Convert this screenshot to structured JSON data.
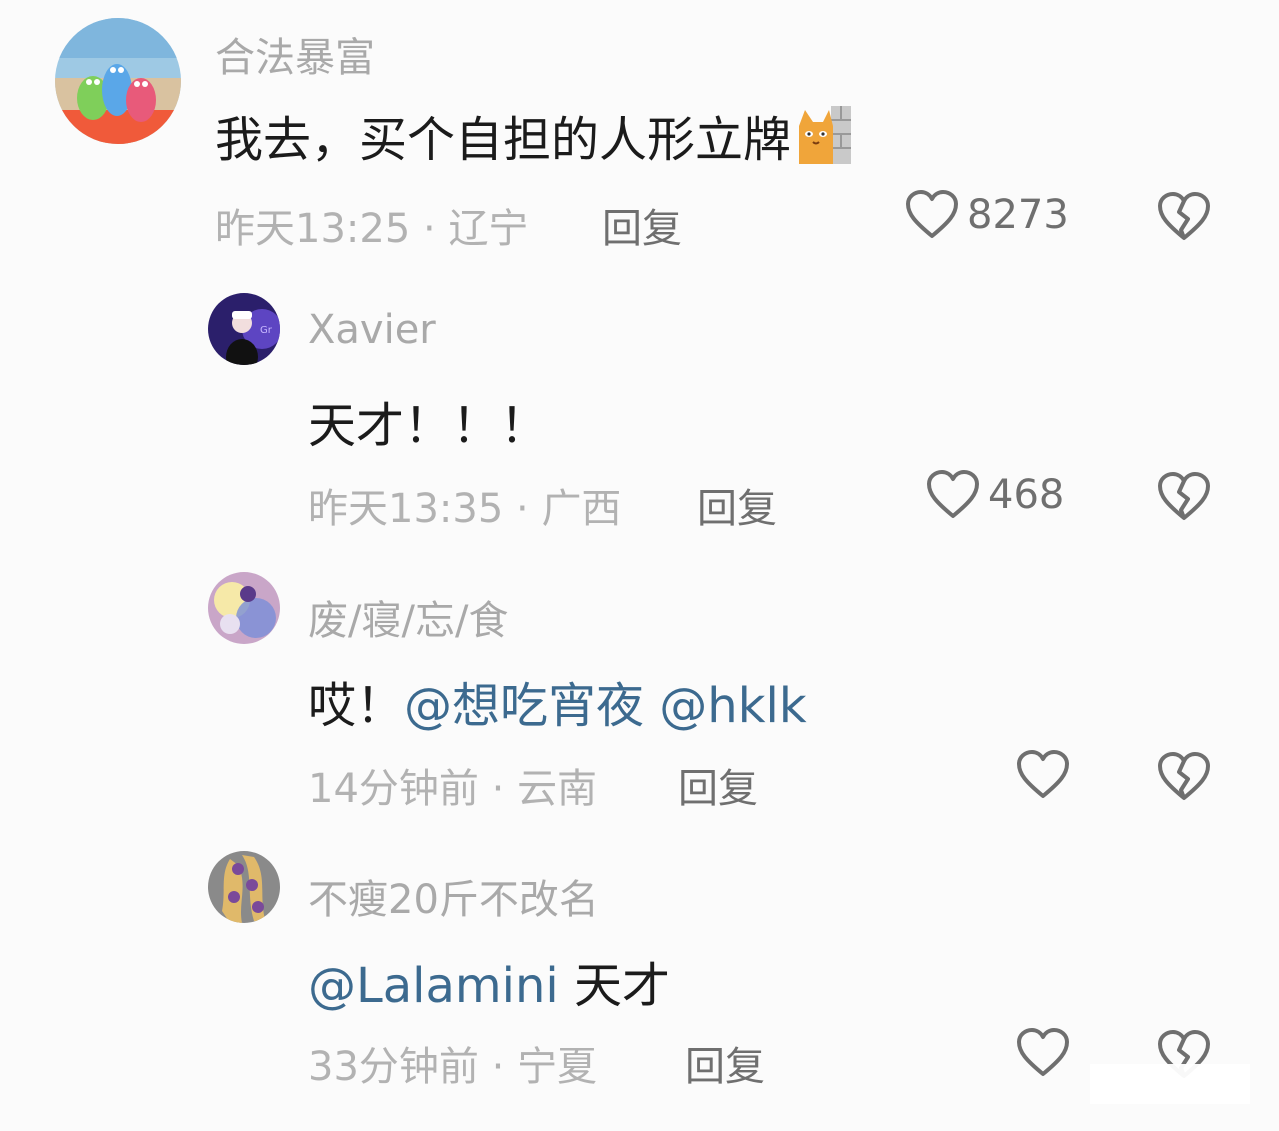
{
  "comments": [
    {
      "username": "合法暴富",
      "text": "我去，买个自担的人形立牌",
      "emoji": "cat-wall-emoji",
      "time": "昨天13:25",
      "separator": " · ",
      "location": "辽宁",
      "reply_label": "回复",
      "likes": "8273"
    },
    {
      "username": "Xavier",
      "text": "天才！！！",
      "time": "昨天13:35",
      "separator": " · ",
      "location": "广西",
      "reply_label": "回复",
      "likes": "468"
    },
    {
      "username": "废/寝/忘/食",
      "text_prefix": "哎！",
      "mention1": "@想吃宵夜",
      "mention2": "@hklk",
      "time": "14分钟前",
      "separator": " · ",
      "location": "云南",
      "reply_label": "回复",
      "likes": ""
    },
    {
      "username": "不瘦20斤不改名",
      "mention1": "@Lalamini",
      "text_suffix": " 天才",
      "time": "33分钟前",
      "separator": " · ",
      "location": "宁夏",
      "reply_label": "回复",
      "likes": ""
    }
  ],
  "icons": {
    "like": "heart-outline-icon",
    "dislike": "broken-heart-icon"
  },
  "colors": {
    "username": "#a9a9a9",
    "text": "#1b1b1b",
    "mention": "#3c6a8f",
    "meta": "#b2b2b2",
    "action": "#6f6f6f"
  }
}
